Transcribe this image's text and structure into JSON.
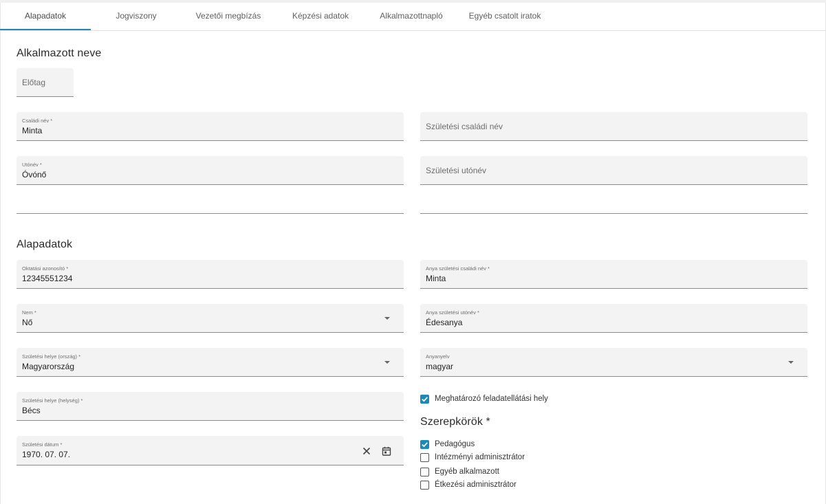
{
  "tabs": [
    {
      "label": "Alapadatok",
      "active": true
    },
    {
      "label": "Jogviszony",
      "active": false
    },
    {
      "label": "Vezetői megbízás",
      "active": false
    },
    {
      "label": "Képzési adatok",
      "active": false
    },
    {
      "label": "Alkalmazottnapló",
      "active": false
    },
    {
      "label": "Egyéb csatolt iratok",
      "active": false
    }
  ],
  "name_section": {
    "title": "Alkalmazott neve",
    "prefix": {
      "placeholder": "Előtag"
    },
    "family_name": {
      "label": "Családi név *",
      "value": "Minta"
    },
    "birth_family_name": {
      "placeholder": "Születési családi név"
    },
    "given_name": {
      "label": "Utónév *",
      "value": "Óvónő"
    },
    "birth_given_name": {
      "placeholder": "Születési utónév"
    }
  },
  "basic_section": {
    "title": "Alapadatok",
    "education_id": {
      "label": "Oktatási azonosító *",
      "value": "12345551234"
    },
    "mother_family_name": {
      "label": "Anya születési családi név *",
      "value": "Minta"
    },
    "gender": {
      "label": "Nem *",
      "value": "Nő"
    },
    "mother_given_name": {
      "label": "Anya születési utónév *",
      "value": "Édesanya"
    },
    "birth_country": {
      "label": "Születési helye (ország) *",
      "value": "Magyarország"
    },
    "mother_tongue": {
      "label": "Anyanyelv",
      "value": "magyar"
    },
    "birth_city": {
      "label": "Születési helye (helység) *",
      "value": "Bécs"
    },
    "birth_date": {
      "label": "Születési dátum *",
      "value": "1970. 07. 07."
    },
    "main_workplace": {
      "label": "Meghatározó feladatellátási hely",
      "checked": true
    }
  },
  "roles_section": {
    "title": "Szerepkörök *",
    "roles": [
      {
        "label": "Pedagógus",
        "checked": true
      },
      {
        "label": "Intézményi adminisztrátor",
        "checked": false
      },
      {
        "label": "Egyéb alkalmazott",
        "checked": false
      },
      {
        "label": "Étkezési adminisztrátor",
        "checked": false
      }
    ]
  },
  "colors": {
    "accent": "#1e88b6",
    "field_bg": "#f3f3f3"
  },
  "icons": {
    "dropdown": "caret-down-icon",
    "clear": "close-icon",
    "calendar": "calendar-icon",
    "check": "check-icon"
  }
}
